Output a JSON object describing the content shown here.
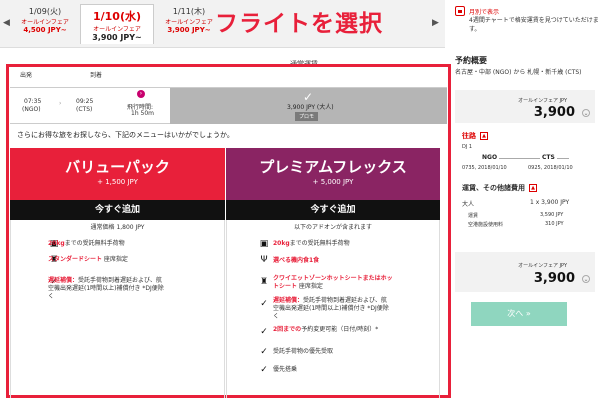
{
  "overlay_title": "フライトを選択",
  "date_bar": {
    "prev_arrow": "◀",
    "next_arrow": "▶",
    "tabs": [
      {
        "date": "1/09(火)",
        "sub": "オールインフェア",
        "price": "4,500 JPY~"
      },
      {
        "date": "1/10(水)",
        "sub": "オールインフェア",
        "price": "3,900 JPY~"
      },
      {
        "date": "1/11(木)",
        "sub": "オールインフェア",
        "price": "3,900 JPY~"
      }
    ],
    "monthly": {
      "line1": "月別で表示",
      "line2": "4週間チャートで格安運賃を見つけていただけます。"
    }
  },
  "fare_heading": "通常運賃",
  "columns": {
    "departure": "出発",
    "arrival": "到着"
  },
  "flight": {
    "dep_time": "07:35",
    "dep_code": "(NGO)",
    "arr_time": "09:25",
    "arr_code": "(CTS)",
    "duration_label": "飛行時間:",
    "duration": "1h 50m",
    "promo_price": "3,900 JPY (大人)",
    "promo_badge": "プロモ"
  },
  "suggest_text": "さらにお得な旅をお探しなら、下記のメニューはいかがでしょうか。",
  "value_pack": {
    "name": "バリューパック",
    "add_price": "+ 1,500 JPY",
    "button": "今すぐ追加",
    "note": "通常価格 1,800 JPY",
    "features": [
      {
        "highlight": "20kg",
        "text": "までの受託無料手荷物"
      },
      {
        "highlight": "スタンダードシート",
        "text": " 座席指定"
      },
      {
        "highlight": "遅延補償：",
        "text": "受託手荷物到着遅延および、航空機出発遅延(1時間以上)補償付き *DJ便除く"
      }
    ]
  },
  "premium_flex": {
    "name": "プレミアムフレックス",
    "add_price": "+ 5,000 JPY",
    "button": "今すぐ追加",
    "note": "以下のアドオンが含まれます",
    "features": [
      {
        "highlight": "20kg",
        "text": "までの受託無料手荷物"
      },
      {
        "highlight": "選べる機内食1食",
        "text": ""
      },
      {
        "highlight": "クワイエットゾーンホットシートまたはホットシート",
        "text": " 座席指定"
      },
      {
        "highlight": "遅延補償：",
        "text": "受託手荷物到着遅延および、航空機出発遅延(1時間以上)補償付き *DJ便除く"
      },
      {
        "highlight": "2回までの",
        "text": "予約変更可能（日付/時刻）*"
      },
      {
        "highlight": "",
        "text": "受託手荷物の優先受取"
      },
      {
        "highlight": "",
        "text": "優先搭乗"
      }
    ]
  },
  "sidebar": {
    "title": "予約概要",
    "route": "名古屋・中部 (NGO) から 札幌・新千歳 (CTS)",
    "fare_label": "オールインフェア JPY",
    "fare_amount": "3,900",
    "outbound_label": "往路",
    "toggle": "▲",
    "flight_no": "DJ 1",
    "from_code": "NGO",
    "to_code": "CTS",
    "from_time": "0735, 2018/01/10",
    "to_time": "0925, 2018/01/10",
    "fees_label": "運賃、その他諸費用",
    "adult_label": "大人",
    "adult_value": "1 x 3,900 JPY",
    "fare_row_label": "運賃",
    "fare_row_value": "3,590 JPY",
    "fac_row_label": "空港施設使用料",
    "fac_row_value": "310 JPY",
    "total_label": "オールインフェア JPY",
    "total_amount": "3,900",
    "next_button": "次へ »"
  },
  "icons": {
    "baggage": "baggage-icon",
    "seat": "seat-icon",
    "check": "check-icon",
    "meal": "meal-icon"
  },
  "colors": {
    "brand_red": "#e8203a",
    "premium_purple": "#8a2463",
    "next_green": "#8fd6bf"
  }
}
